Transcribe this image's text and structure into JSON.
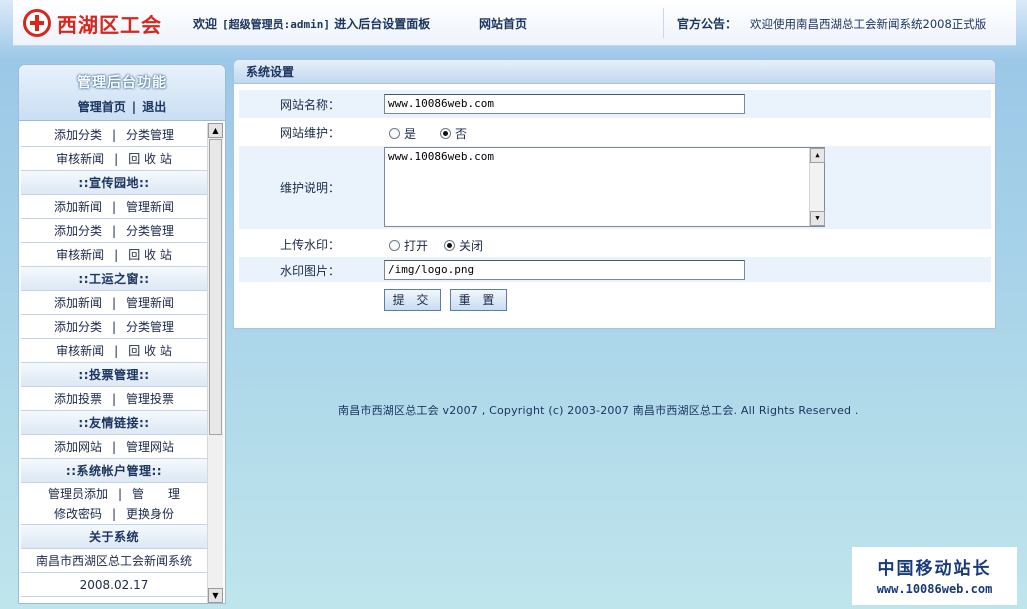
{
  "header": {
    "logo_text": "西湖区工会",
    "welcome_prefix": "欢迎",
    "welcome_admin": "[超级管理员:admin]",
    "welcome_suffix": "进入后台设置面板",
    "home_link": "网站首页",
    "announce_label": "官方公告：",
    "announce_text": "欢迎使用南昌西湖总工会新闻系统2008正式版"
  },
  "sidebar": {
    "title": "管理后台功能",
    "home_link": "管理首页",
    "separator": "|",
    "logout_link": "退出",
    "rows": {
      "r1": {
        "a": "添加分类",
        "b": "分类管理"
      },
      "r2": {
        "a": "审核新闻",
        "b": "回 收 站"
      },
      "s1": "::宣传园地::",
      "r3": {
        "a": "添加新闻",
        "b": "管理新闻"
      },
      "r4": {
        "a": "添加分类",
        "b": "分类管理"
      },
      "r5": {
        "a": "审核新闻",
        "b": "回 收 站"
      },
      "s2": "::工运之窗::",
      "r6": {
        "a": "添加新闻",
        "b": "管理新闻"
      },
      "r7": {
        "a": "添加分类",
        "b": "分类管理"
      },
      "r8": {
        "a": "审核新闻",
        "b": "回 收 站"
      },
      "s3": "::投票管理::",
      "r9": {
        "a": "添加投票",
        "b": "管理投票"
      },
      "s4": "::友情链接::",
      "r10": {
        "a": "添加网站",
        "b": "管理网站"
      },
      "s5": "::系统帐户管理::",
      "r11": {
        "a": "管理员添加",
        "b": "管　　理"
      },
      "r12": {
        "a": "修改密码",
        "b": "更换身份"
      },
      "s6": "关于系统",
      "about_name": "南昌市西湖区总工会新闻系统",
      "about_date": "2008.02.17"
    }
  },
  "panel": {
    "title": "系统设置",
    "site_name_label": "网站名称：",
    "site_name_value": "www.10086web.com",
    "maintenance_label": "网站维护：",
    "maintenance_yes": "是",
    "maintenance_no": "否",
    "maintenance_selected": "否",
    "maintenance_note_label": "维护说明：",
    "maintenance_note_value": "www.10086web.com",
    "watermark_label": "上传水印：",
    "watermark_on": "打开",
    "watermark_off": "关闭",
    "watermark_selected": "关闭",
    "watermark_image_label": "水印图片：",
    "watermark_image_value": "/img/logo.png",
    "submit_label": "提 交",
    "reset_label": "重 置"
  },
  "footer": {
    "copyright": "南昌市西湖区总工会 v2007 , Copyright (c) 2003-2007 南昌市西湖区总工会. All Rights Reserved ."
  },
  "watermark_badge": {
    "title": "中国移动站长",
    "url": "www.10086web.com"
  },
  "colors": {
    "brand_red": "#d8261c",
    "nav_text": "#1c3560",
    "panel_border": "#a9c3de",
    "row_alt": "#eaf3fc"
  },
  "icons": {
    "logo": "union-emblem-icon",
    "scroll_up": "scroll-up-arrow-icon",
    "scroll_down": "scroll-down-arrow-icon"
  }
}
